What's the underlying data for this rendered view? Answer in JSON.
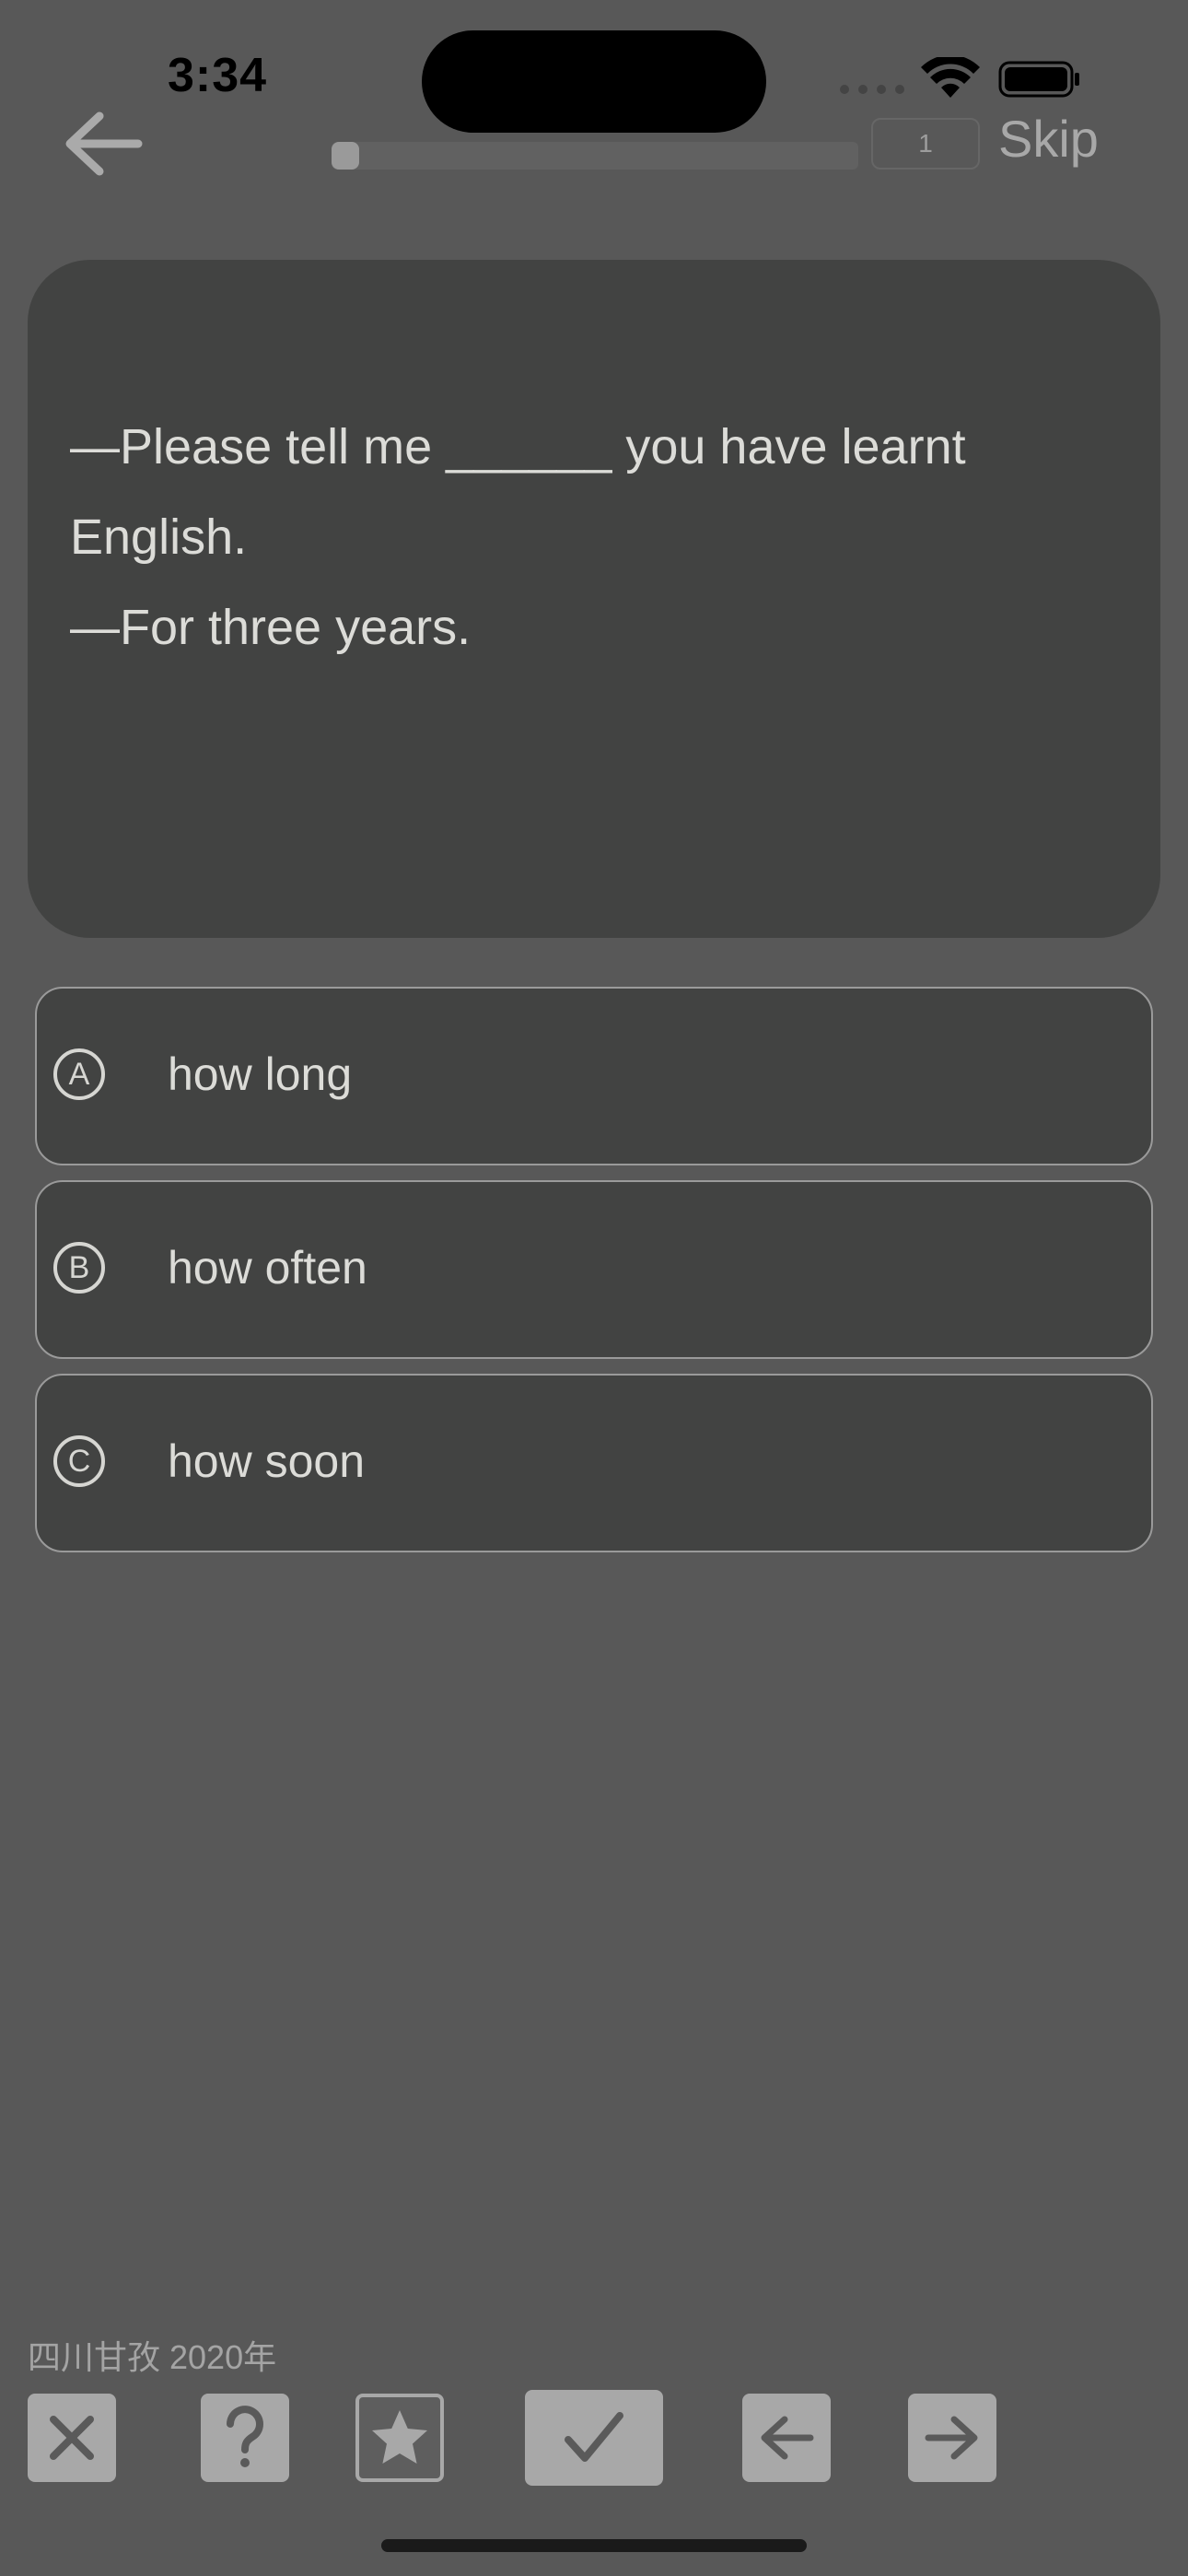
{
  "status_bar": {
    "time": "3:34"
  },
  "top_bar": {
    "counter": "1",
    "skip_label": "Skip",
    "progress_fraction": 0.04
  },
  "question": {
    "lines": [
      "—Please tell me ______ you have learnt",
      "English.",
      "—For three years."
    ]
  },
  "options": [
    {
      "letter": "A",
      "text": "how long"
    },
    {
      "letter": "B",
      "text": "how often"
    },
    {
      "letter": "C",
      "text": "how soon"
    }
  ],
  "footer": {
    "source": "四川甘孜 2020年",
    "tools": [
      "close-icon",
      "help-icon",
      "star-icon",
      "check-icon",
      "arrow-left-icon",
      "arrow-right-icon"
    ]
  }
}
